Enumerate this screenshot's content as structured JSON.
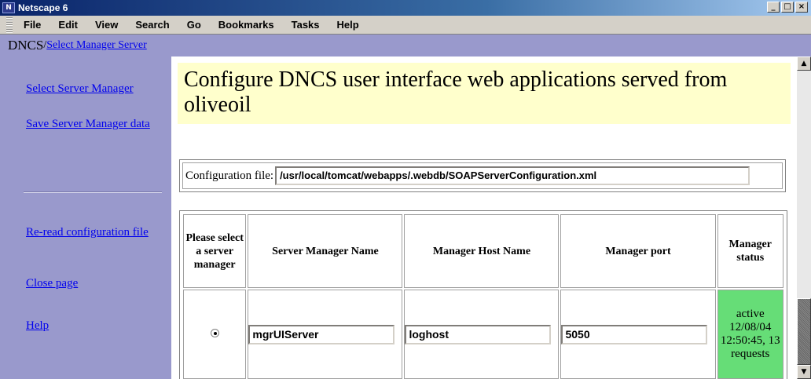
{
  "window": {
    "title": "Netscape 6",
    "icon_label": "N",
    "buttons": {
      "minimize": "_",
      "maximize": "□",
      "close": "×"
    }
  },
  "menu": [
    "File",
    "Edit",
    "View",
    "Search",
    "Go",
    "Bookmarks",
    "Tasks",
    "Help"
  ],
  "breadcrumb": {
    "root": "DNCS",
    "separator": "/",
    "link": "Select Manager Server"
  },
  "sidebar": {
    "items": [
      {
        "label": "Select Server Manager"
      },
      {
        "label": "Save Server Manager data"
      },
      {
        "label": "Re-read configuration file"
      },
      {
        "label": "Close page"
      },
      {
        "label": "Help"
      }
    ]
  },
  "main": {
    "heading": "Configure DNCS user interface web applications served from oliveoil",
    "config_label": "Configuration file:",
    "config_value": "/usr/local/tomcat/webapps/.webdb/SOAPServerConfiguration.xml",
    "table": {
      "headers": [
        "Please select a server manager",
        "Server Manager Name",
        "Manager Host Name",
        "Manager port",
        "Manager status"
      ],
      "rows": [
        {
          "selected": true,
          "name": "mgrUIServer",
          "host": "loghost",
          "port": "5050",
          "status": "active 12/08/04 12:50:45, 13 requests"
        }
      ]
    }
  },
  "colors": {
    "sidebar": "#9999cc",
    "heading_bg": "#ffffcc",
    "status_ok": "#66dd77",
    "link": "#0000ee"
  }
}
